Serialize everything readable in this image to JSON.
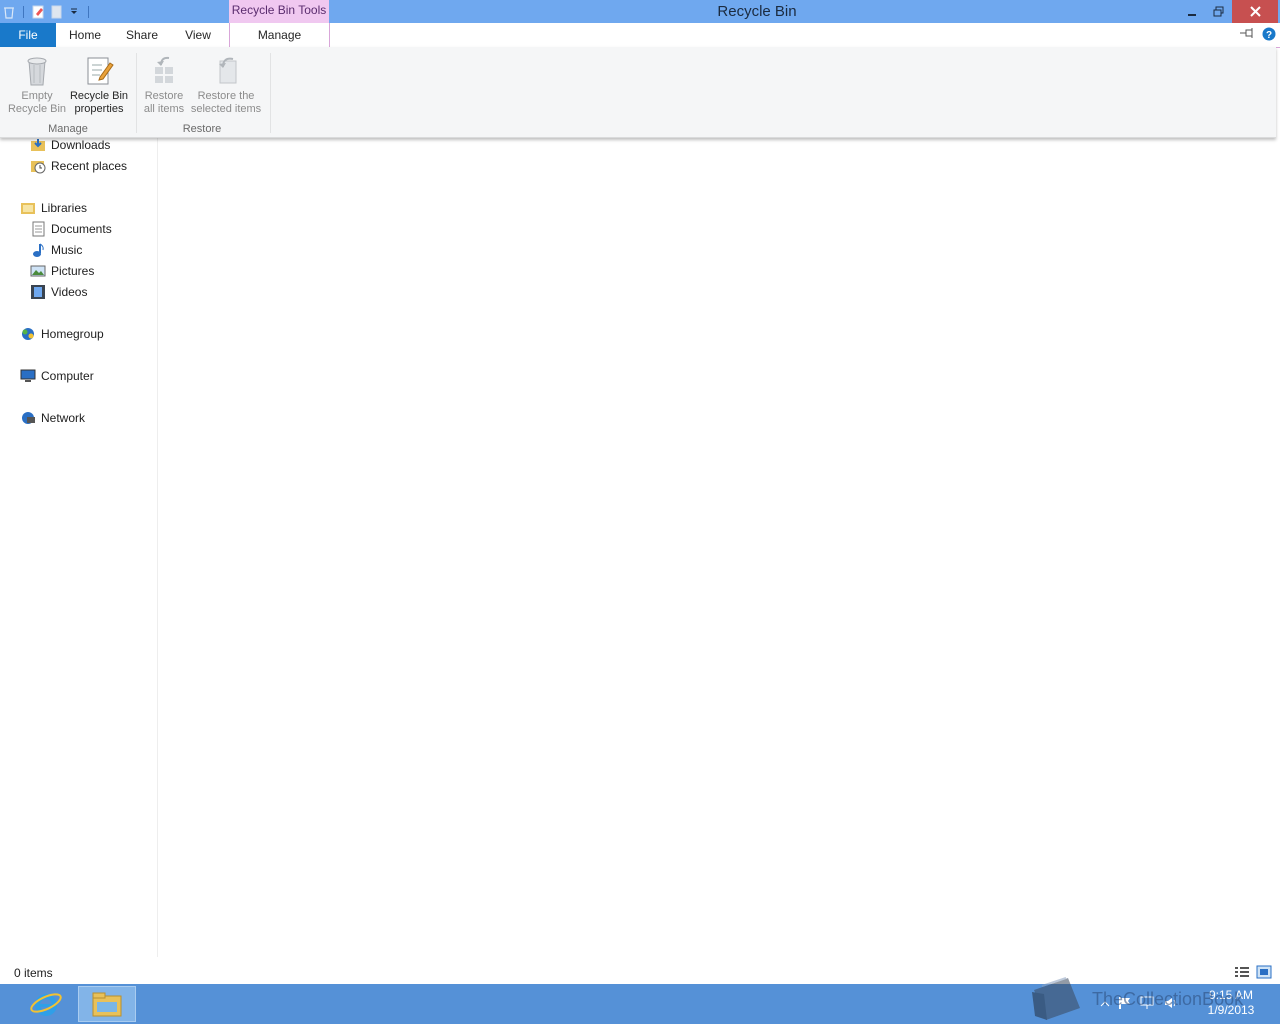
{
  "window": {
    "title": "Recycle Bin",
    "contextual_tab_group": "Recycle Bin Tools"
  },
  "tabs": [
    "File",
    "Home",
    "Share",
    "View",
    "Manage"
  ],
  "ribbon": {
    "manage_group": {
      "label": "Manage",
      "empty_recycle_bin": [
        "Empty",
        "Recycle Bin"
      ],
      "recycle_bin_properties": [
        "Recycle Bin",
        "properties"
      ]
    },
    "restore_group": {
      "label": "Restore",
      "restore_all": [
        "Restore",
        "all items"
      ],
      "restore_selected": [
        "Restore the",
        "selected items"
      ]
    }
  },
  "nav": {
    "favorites_children": [
      "Downloads",
      "Recent places"
    ],
    "libraries": {
      "label": "Libraries",
      "children": [
        "Documents",
        "Music",
        "Pictures",
        "Videos"
      ]
    },
    "homegroup": "Homegroup",
    "computer": "Computer",
    "network": "Network"
  },
  "status": {
    "item_count": "0 items"
  },
  "taskbar": {
    "clock_time": "9:15 AM",
    "clock_date": "1/9/2013"
  },
  "watermark": "TheCollectionBook",
  "colors": {
    "titlebar": "#6fa8ef",
    "file_tab": "#1979ca",
    "contextual": "#f0c8f0",
    "close": "#c75050",
    "taskbar": "#5591d7"
  }
}
